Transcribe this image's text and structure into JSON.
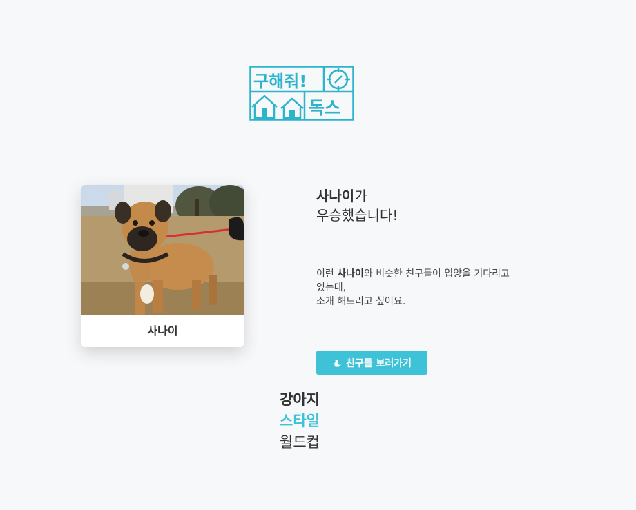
{
  "logo": {
    "line1": "구해줘!",
    "line2": "독스",
    "color": "#2bb4cc"
  },
  "result": {
    "winner_name": "사나이",
    "headline_suffix": "가",
    "headline_line2": "우승했습니다!",
    "desc_prefix": "이런 ",
    "desc_name": "사나이",
    "desc_line1_rest": "와 비슷한 친구들이 입양을 기다리고",
    "desc_line2": "있는데,",
    "desc_line3": "소개 해드리고 싶어요."
  },
  "card": {
    "label": "사나이"
  },
  "cta": {
    "label": "친구들 보러가기",
    "icon": "dog-icon",
    "color": "#3dc2d8"
  },
  "worldcup": {
    "line1": "강아지",
    "line2": "스타일",
    "line3": "월드컵"
  }
}
